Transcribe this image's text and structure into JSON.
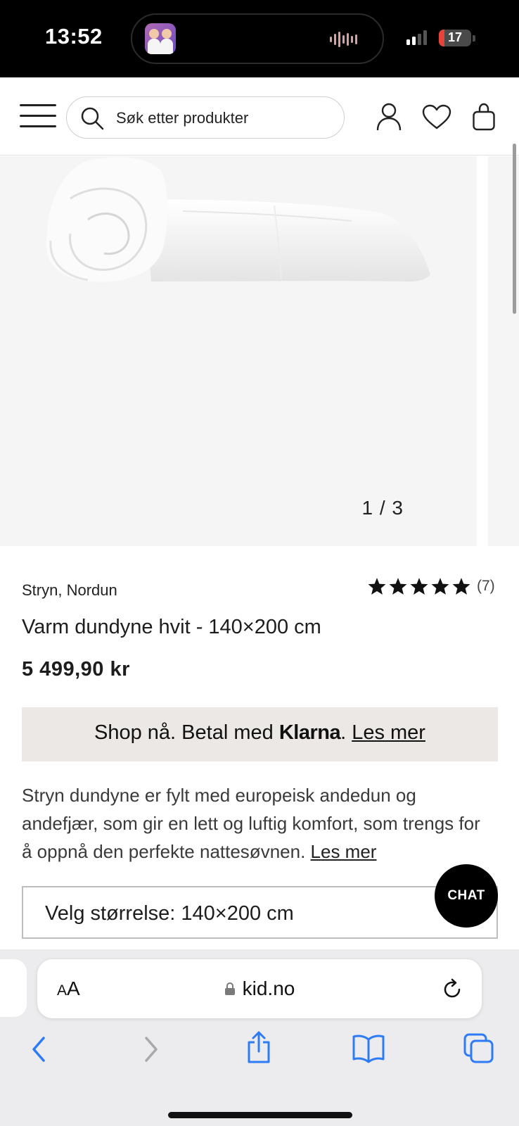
{
  "status_bar": {
    "time": "13:52",
    "battery_level": "17"
  },
  "header": {
    "search_placeholder": "Søk etter produkter",
    "icons": [
      "menu-icon",
      "search-icon",
      "account-icon",
      "wishlist-heart-icon",
      "cart-bag-icon"
    ]
  },
  "gallery": {
    "counter": "1 / 3",
    "current": 1,
    "total": 3
  },
  "product": {
    "brand": "Stryn, Nordun",
    "rating_stars": 5,
    "review_count": "(7)",
    "title": "Varm dundyne hvit - 140×200 cm",
    "price": "5 499,90 kr",
    "klarna": {
      "prefix": "Shop nå. Betal med ",
      "brand": "Klarna",
      "separator": ". ",
      "link": "Les mer"
    },
    "description": "Stryn dundyne er fylt med europeisk andedun og andefjær, som gir en lett og luftig komfort, som trengs for å oppnå den perfekte nattesøvnen.",
    "description_link": "Les mer",
    "size_select": "Velg størrelse: 140×200 cm"
  },
  "chat": {
    "label": "CHAT"
  },
  "browser": {
    "text_size_label_small": "A",
    "text_size_label_large": "A",
    "url": "kid.no",
    "toolbar": [
      "back-icon",
      "forward-icon",
      "share-icon",
      "bookmarks-icon",
      "tabs-icon"
    ]
  },
  "colors": {
    "accent_link": "#2f7bf6",
    "klarna_bg": "#ebe8e5",
    "image_bg": "#f5f5f5",
    "chat_bg": "#000000"
  }
}
